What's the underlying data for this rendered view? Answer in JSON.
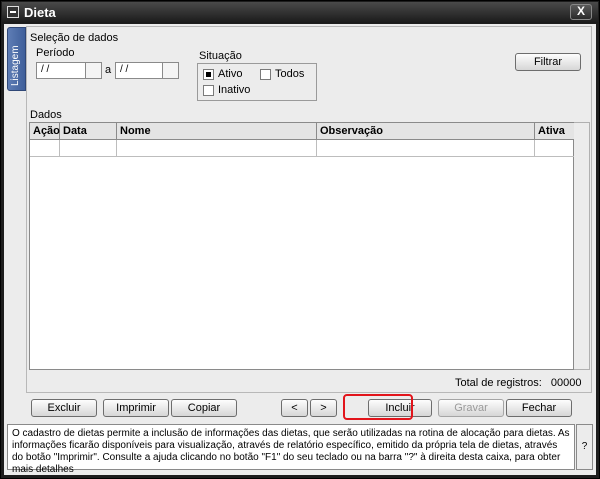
{
  "window": {
    "title": "Dieta",
    "close_label": "X"
  },
  "side_tab": {
    "label": "Listagem"
  },
  "selecao": {
    "group_label": "Seleção de dados",
    "periodo_label": "Período",
    "date_from": "/ /",
    "date_sep": "a",
    "date_to": "/ /",
    "situacao_label": "Situação",
    "ativo_label": "Ativo",
    "todos_label": "Todos",
    "inativo_label": "Inativo",
    "filtrar_label": "Filtrar"
  },
  "dados": {
    "group_label": "Dados",
    "columns": [
      "Ação",
      "Data",
      "Nome",
      "Observação",
      "Ativa"
    ],
    "total_label": "Total de registros:",
    "total_value": "00000"
  },
  "toolbar": {
    "excluir": "Excluir",
    "imprimir": "Imprimir",
    "copiar": "Copiar",
    "prev": "<",
    "next": ">",
    "incluir": "Incluir",
    "gravar": "Gravar",
    "fechar": "Fechar"
  },
  "info": {
    "text": "O cadastro de dietas permite a inclusão de informações das dietas, que serão utilizadas na rotina de alocação para dietas. As informações ficarão disponíveis para visualização, através de relatório específico, emitido da própria tela de dietas, através do botão \"Imprimir\". Consulte a ajuda clicando no botão \"F1\" do seu teclado ou na barra \"?\" à direita desta caixa, para obter mais detalhes",
    "help_label": "?"
  },
  "colors": {
    "highlight": "#e2141b",
    "tab": "#4a6aa5"
  }
}
